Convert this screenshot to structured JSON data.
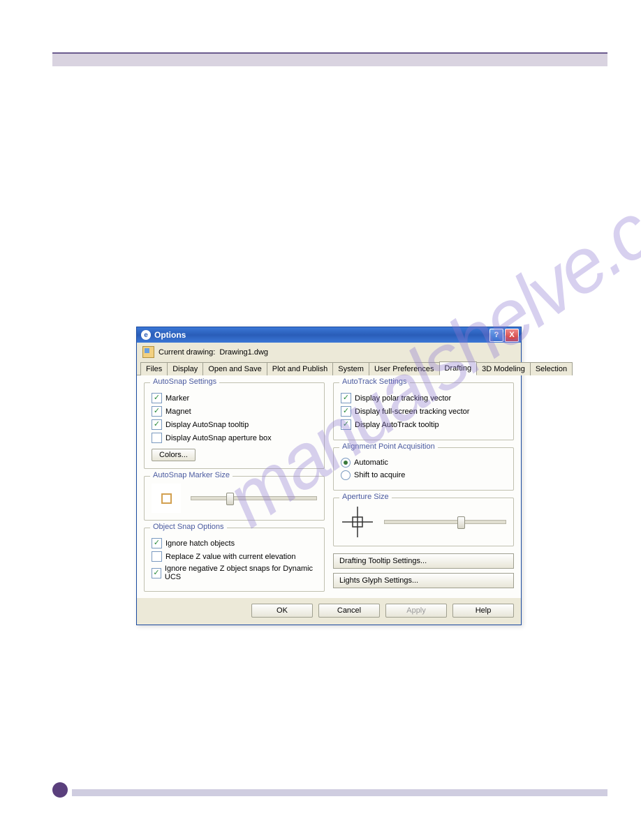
{
  "titlebar": {
    "title": "Options",
    "help_glyph": "?",
    "close_glyph": "X"
  },
  "subheader": {
    "label": "Current drawing:",
    "value": "Drawing1.dwg"
  },
  "tabs": [
    {
      "label": "Files"
    },
    {
      "label": "Display"
    },
    {
      "label": "Open and Save"
    },
    {
      "label": "Plot and Publish"
    },
    {
      "label": "System"
    },
    {
      "label": "User Preferences"
    },
    {
      "label": "Drafting",
      "active": true
    },
    {
      "label": "3D Modeling"
    },
    {
      "label": "Selection"
    }
  ],
  "autosnap_settings": {
    "title": "AutoSnap Settings",
    "marker": "Marker",
    "magnet": "Magnet",
    "tooltip": "Display AutoSnap tooltip",
    "aperture": "Display AutoSnap aperture box",
    "colors_btn": "Colors..."
  },
  "autosnap_marker_size": {
    "title": "AutoSnap Marker Size"
  },
  "object_snap_options": {
    "title": "Object Snap Options",
    "ignore_hatch": "Ignore hatch objects",
    "replace_z": "Replace Z value with current elevation",
    "ignore_neg_z": "Ignore negative Z object snaps for Dynamic UCS"
  },
  "autotrack_settings": {
    "title": "AutoTrack Settings",
    "polar": "Display polar tracking vector",
    "fullscreen": "Display full-screen tracking vector",
    "tooltip": "Display AutoTrack tooltip"
  },
  "alignment_point": {
    "title": "Alignment Point Acquisition",
    "automatic": "Automatic",
    "shift": "Shift to acquire"
  },
  "aperture_size": {
    "title": "Aperture Size"
  },
  "right_buttons": {
    "tooltip_settings": "Drafting Tooltip Settings...",
    "lights_glyph": "Lights Glyph Settings..."
  },
  "footer": {
    "ok": "OK",
    "cancel": "Cancel",
    "apply": "Apply",
    "help": "Help"
  },
  "watermark": "manualshelve.com"
}
